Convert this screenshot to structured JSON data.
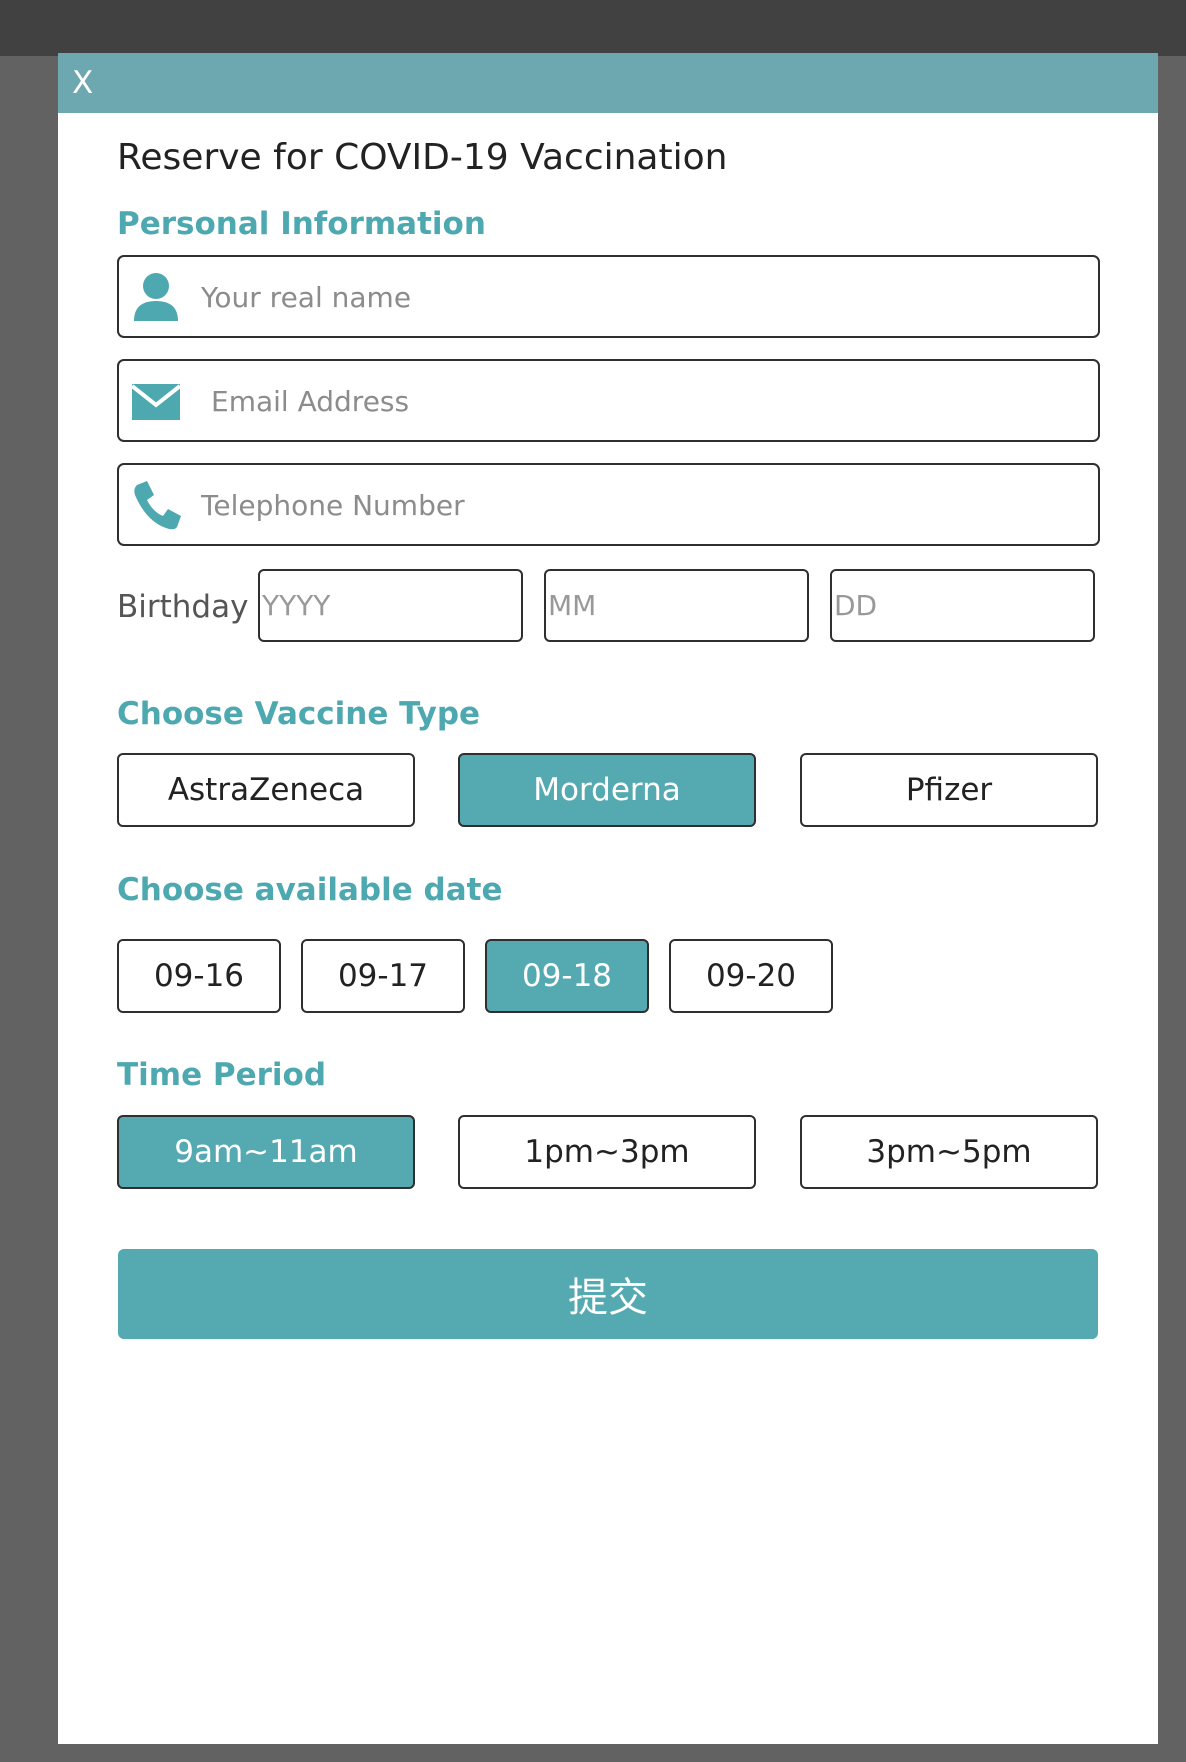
{
  "dialog": {
    "close_label": "X",
    "title": "Reserve for COVID-19 Vaccination"
  },
  "personal": {
    "section_title": "Personal Information",
    "name_placeholder": "Your real name",
    "email_placeholder": "Email Address",
    "phone_placeholder": "Telephone Number",
    "birthday_label": "Birthday",
    "year_placeholder": "YYYY",
    "month_placeholder": "MM",
    "day_placeholder": "DD"
  },
  "vaccine": {
    "section_title": "Choose Vaccine Type",
    "options": [
      "AstraZeneca",
      "Morderna",
      "Pfizer"
    ],
    "selected": "Morderna"
  },
  "date": {
    "section_title": "Choose available date",
    "options": [
      "09-16",
      "09-17",
      "09-18",
      "09-20"
    ],
    "selected": "09-18"
  },
  "time": {
    "section_title": "Time Period",
    "options": [
      "9am~11am",
      "1pm~3pm",
      "3pm~5pm"
    ],
    "selected": "9am~11am"
  },
  "submit_label": "提交",
  "colors": {
    "accent": "#55aab2",
    "header": "#6da8b0",
    "label": "#4da8b0"
  }
}
